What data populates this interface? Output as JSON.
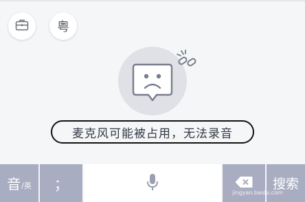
{
  "top_buttons": {
    "toolbox": {
      "icon": "briefcase-icon"
    },
    "cantonese": {
      "label": "粤"
    }
  },
  "voice_status": {
    "icon": "sad-speech-bubble-icon",
    "disconnected_icon": "broken-link-icon",
    "message": "麦克风可能被占用，无法录音"
  },
  "keyboard": {
    "lang_key": {
      "main": "音",
      "sub": "/英"
    },
    "semicolon_key": "；",
    "mic_key": {
      "icon": "microphone-icon"
    },
    "backspace_key": {
      "icon": "backspace-icon"
    },
    "search_key": "搜索"
  },
  "watermark": "jingyan.baidu.com",
  "colors": {
    "background": "#f5f6f8",
    "function_key": "#a9adc1",
    "icon_gray": "#777d8a",
    "status_circle": "#dfe1e6"
  }
}
